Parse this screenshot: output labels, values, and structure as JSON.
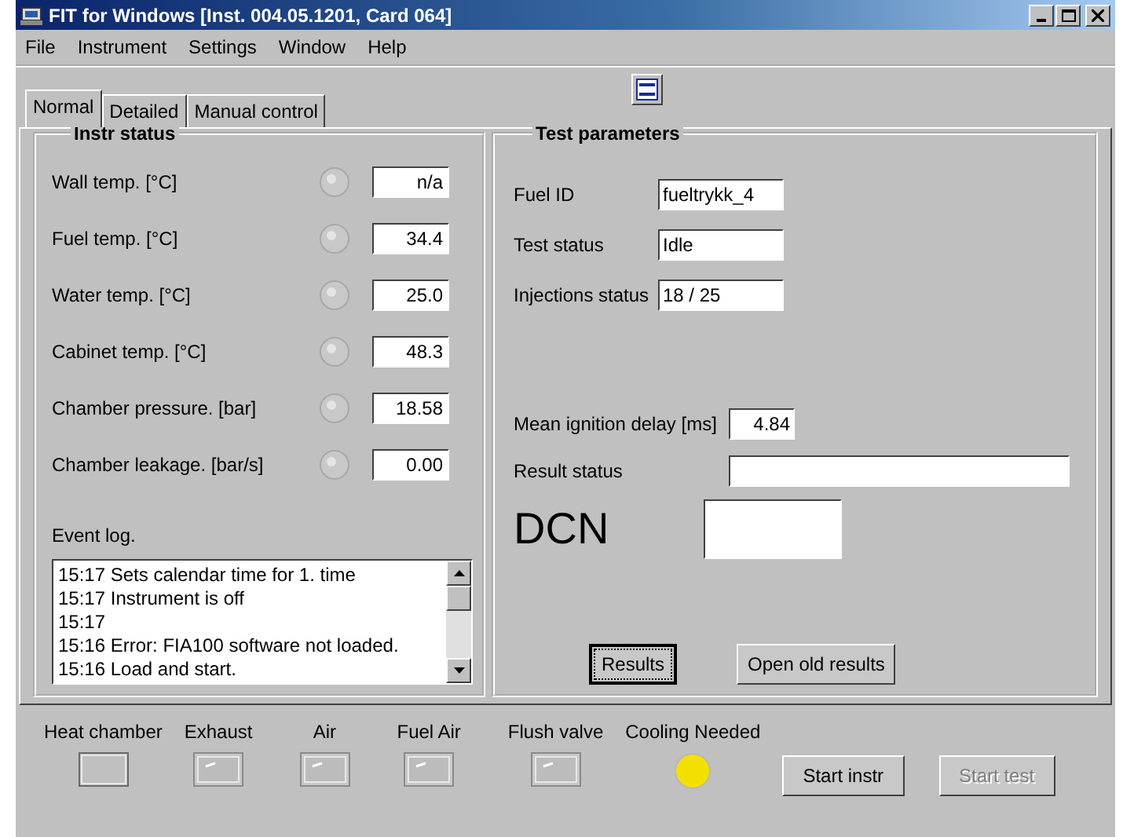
{
  "window": {
    "title": "FIT for Windows [Inst. 004.05.1201, Card 064]"
  },
  "menu": [
    {
      "label": "File"
    },
    {
      "label": "Instrument"
    },
    {
      "label": "Settings"
    },
    {
      "label": "Window"
    },
    {
      "label": "Help"
    }
  ],
  "tabs": [
    {
      "label": "Normal",
      "selected": true
    },
    {
      "label": "Detailed",
      "selected": false
    },
    {
      "label": "Manual control",
      "selected": false
    }
  ],
  "instr_status": {
    "title": "Instr status",
    "rows": [
      {
        "label": "Wall temp. [°C]",
        "on": false,
        "value": "n/a"
      },
      {
        "label": "Fuel temp. [°C]",
        "on": false,
        "value": "34.4"
      },
      {
        "label": "Water temp. [°C]",
        "on": false,
        "value": "25.0"
      },
      {
        "label": "Cabinet temp. [°C]",
        "on": false,
        "value": "48.3"
      },
      {
        "label": "Chamber pressure. [bar]",
        "on": false,
        "value": "18.58"
      },
      {
        "label": "Chamber leakage. [bar/s]",
        "on": false,
        "value": "0.00"
      }
    ],
    "event_log": {
      "label": "Event log.",
      "entries": [
        {
          "time": "15:17",
          "text": "Sets calendar time for 1. time"
        },
        {
          "time": "15:17",
          "text": "Instrument is off"
        },
        {
          "time": "15:17"
        },
        {
          "time": "15:16",
          "text": "Error: FIA100 software not loaded."
        },
        {
          "time": "15:16",
          "text": "Load and start."
        }
      ]
    }
  },
  "test_parameters": {
    "title": "Test parameters",
    "top_fields": [
      {
        "label": "Fuel ID",
        "value": "fueltrykk_4"
      },
      {
        "label": "Test status",
        "value": "Idle"
      },
      {
        "label": "Injections status",
        "value": "18 / 25"
      }
    ],
    "mean_ignition_delay": {
      "label": "Mean ignition delay [ms]",
      "value": "4.84"
    },
    "result_status": {
      "label": "Result status"
    },
    "dcn": {
      "label": "DCN"
    },
    "buttons": [
      {
        "label": "Results",
        "focused": true
      },
      {
        "label": "Open old results",
        "focused": false
      }
    ]
  },
  "bottom_bar": {
    "indicators": [
      {
        "label": "Heat chamber",
        "kind": "frame",
        "on": false
      },
      {
        "label": "Exhaust",
        "kind": "square",
        "on": false
      },
      {
        "label": "Air",
        "kind": "square",
        "on": false
      },
      {
        "label": "Fuel Air",
        "kind": "square",
        "on": false
      },
      {
        "label": "Flush valve",
        "kind": "square",
        "on": false
      },
      {
        "label": "Cooling Needed",
        "kind": "round",
        "on": true
      }
    ],
    "buttons": [
      {
        "label": "Start instr",
        "disabled": false
      },
      {
        "label": "Start test",
        "disabled": true
      }
    ]
  }
}
